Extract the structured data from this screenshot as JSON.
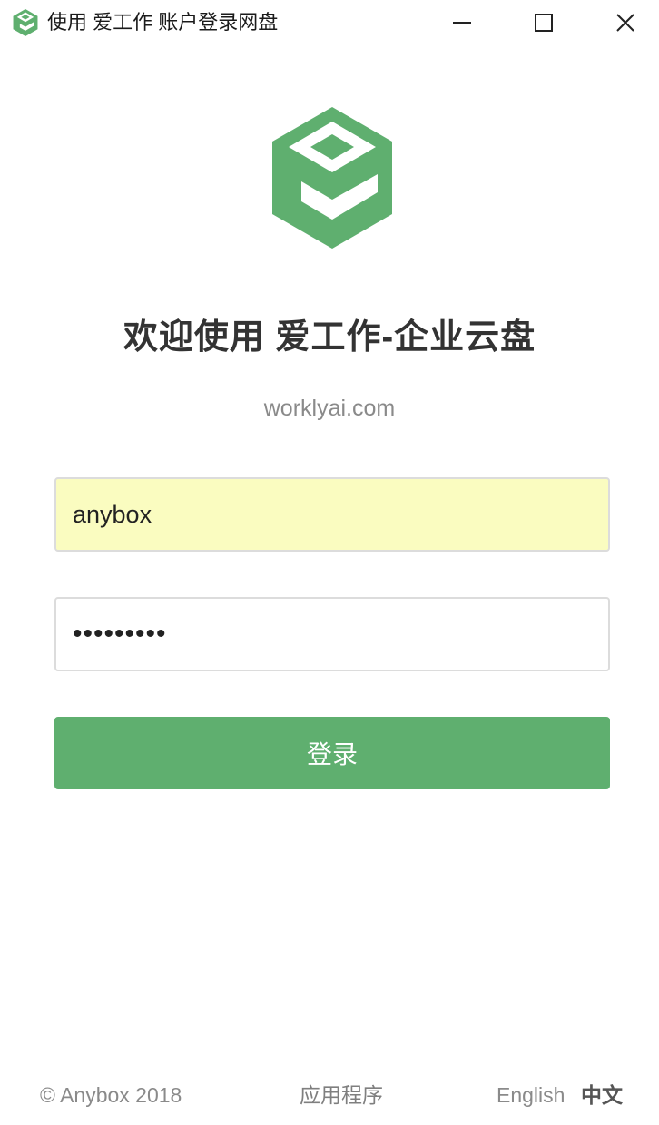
{
  "window": {
    "title": "使用 爱工作 账户登录网盘",
    "icon": "anybox-logo-icon",
    "controls": [
      "minimize-icon",
      "maximize-icon",
      "close-icon"
    ]
  },
  "brand": {
    "logo": "anybox-cube-logo",
    "accent_color": "#5faf6f",
    "headline": "欢迎使用 爱工作-企业云盘",
    "domain": "worklyai.com"
  },
  "form": {
    "username_value": "anybox",
    "password_value": "anybox123",
    "login_label": "登录"
  },
  "footer": {
    "copyright": "© Anybox 2018",
    "apps_link": "应用程序",
    "lang_english": "English",
    "lang_chinese": "中文"
  }
}
